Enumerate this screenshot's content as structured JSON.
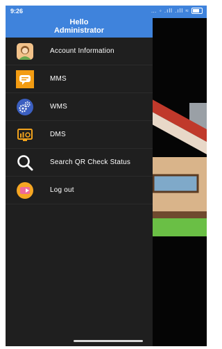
{
  "status_bar": {
    "time": "9:26",
    "icons_text": "… ◦ .ıll .ıll ≈"
  },
  "drawer": {
    "greeting_line1": "Hello",
    "greeting_line2": "Administrator",
    "items": [
      {
        "label": "Account Information",
        "icon": "account-avatar-icon"
      },
      {
        "label": "MMS",
        "icon": "chat-bubble-icon"
      },
      {
        "label": "WMS",
        "icon": "gears-icon"
      },
      {
        "label": "DMS",
        "icon": "dashboard-monitor-icon"
      },
      {
        "label": "Search QR Check Status",
        "icon": "search-icon"
      },
      {
        "label": "Log out",
        "icon": "logout-icon"
      }
    ]
  },
  "colors": {
    "header_blue": "#3f83dc",
    "drawer_bg": "#1f1f1f",
    "text": "#ffffff"
  }
}
